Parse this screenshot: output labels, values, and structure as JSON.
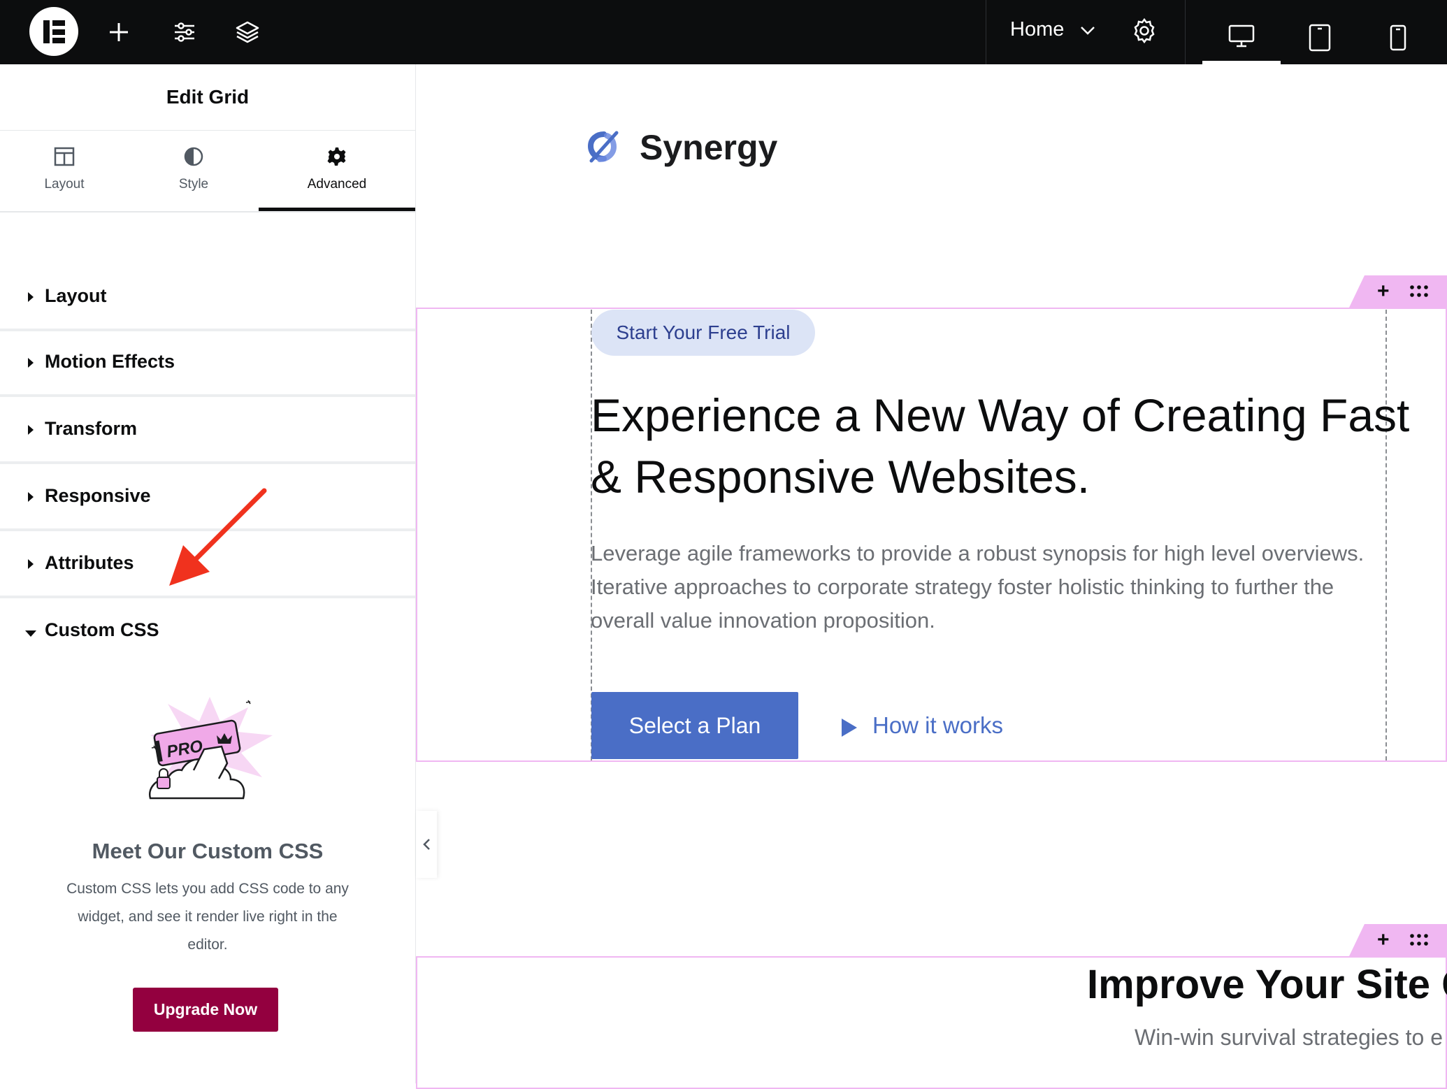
{
  "topbar": {
    "home_label": "Home"
  },
  "panel": {
    "title": "Edit Grid",
    "tabs": [
      {
        "label": "Layout",
        "icon": "columns-icon"
      },
      {
        "label": "Style",
        "icon": "half-circle-icon"
      },
      {
        "label": "Advanced",
        "icon": "gear-icon",
        "active": true
      }
    ],
    "sections": [
      {
        "label": "Layout",
        "expanded": false
      },
      {
        "label": "Motion Effects",
        "expanded": false
      },
      {
        "label": "Transform",
        "expanded": false
      },
      {
        "label": "Responsive",
        "expanded": false
      },
      {
        "label": "Attributes",
        "expanded": false
      },
      {
        "label": "Custom CSS",
        "expanded": true
      }
    ],
    "promo": {
      "badge_text": "PRO",
      "title": "Meet Our Custom CSS",
      "text": "Custom CSS lets you add CSS code to any widget, and see it render live right in the editor.",
      "button": "Upgrade Now"
    }
  },
  "canvas": {
    "brand": "Synergy",
    "pill": "Start Your Free Trial",
    "heading": "Experience a New Way of Creating Fast & Responsive Websites.",
    "paragraph": "Leverage agile frameworks to provide a robust synopsis for high level overviews. Iterative approaches to corporate strategy foster holistic thinking to further the overall value innovation proposition.",
    "primary_button": "Select a Plan",
    "secondary_link": "How it works",
    "section2_heading": "Improve Your Site C",
    "section2_text": "Win-win survival strategies to e"
  },
  "colors": {
    "accent_blue": "#4a6ec6",
    "upgrade_button": "#93003f",
    "section_outline": "#f0b7f2",
    "annotation_arrow": "#f0321e"
  }
}
